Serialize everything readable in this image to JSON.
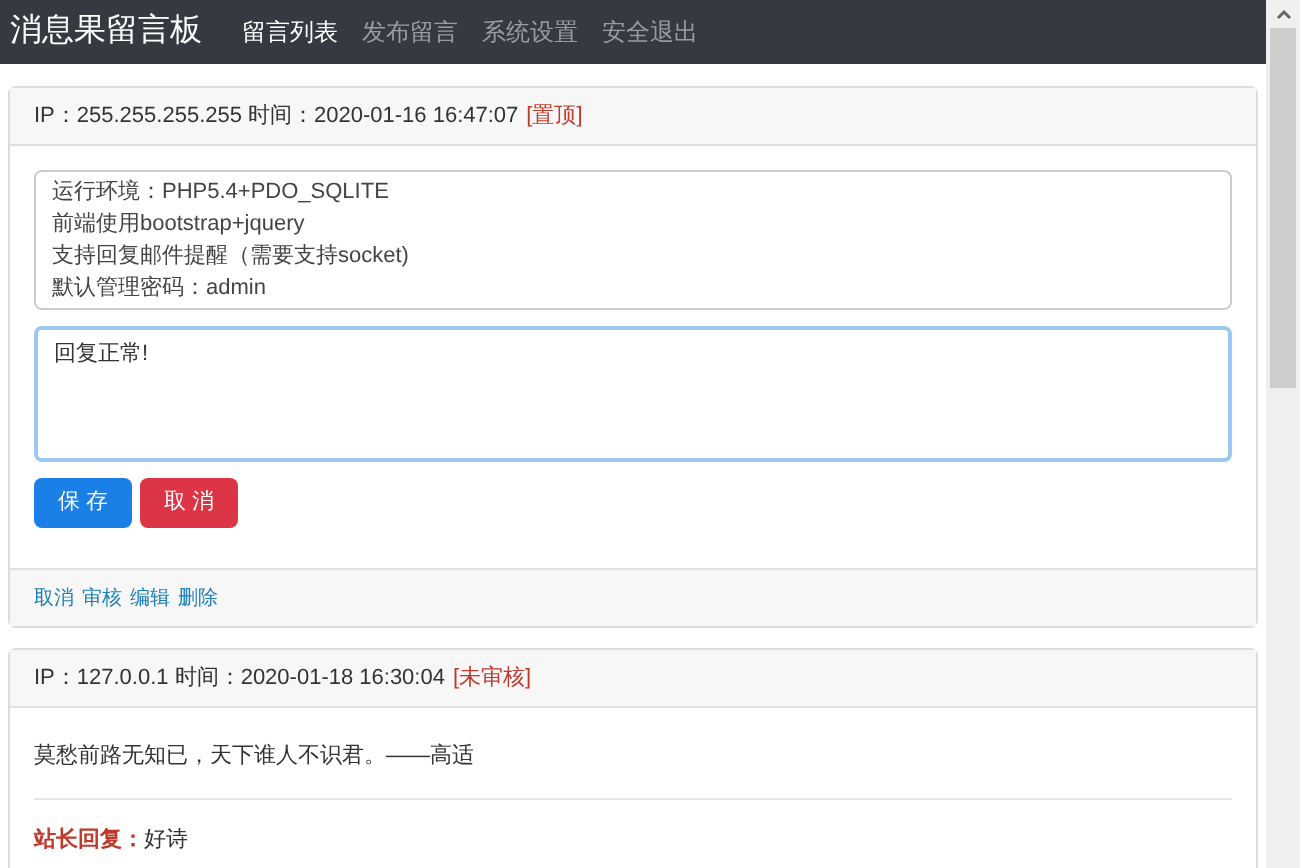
{
  "navbar": {
    "brand": "消息果留言板",
    "items": [
      {
        "label": "留言列表",
        "selected": true
      },
      {
        "label": "发布留言",
        "selected": false
      },
      {
        "label": "系统设置",
        "selected": false
      },
      {
        "label": "安全退出",
        "selected": false
      }
    ]
  },
  "messages": [
    {
      "kind": "editing",
      "meta": "IP：255.255.255.255 时间：2020-01-16 16:47:07",
      "tag": "[置顶]",
      "content": "运行环境：PHP5.4+PDO_SQLITE\n前端使用bootstrap+jquery\n支持回复邮件提醒（需要支持socket)\n默认管理密码：admin",
      "reply_value": "回复正常!",
      "buttons": [
        {
          "label": "保 存",
          "kind": "primary"
        },
        {
          "label": "取 消",
          "kind": "danger"
        }
      ],
      "footer_links": [
        "取消",
        "审核",
        "编辑",
        "删除"
      ]
    },
    {
      "kind": "display",
      "meta": "IP：127.0.0.1 时间：2020-01-18 16:30:04",
      "tag": "[未审核]",
      "content": "莫愁前路无知已，天下谁人不识君。——高适",
      "reply_label": "站长回复：",
      "reply": "好诗"
    }
  ]
}
